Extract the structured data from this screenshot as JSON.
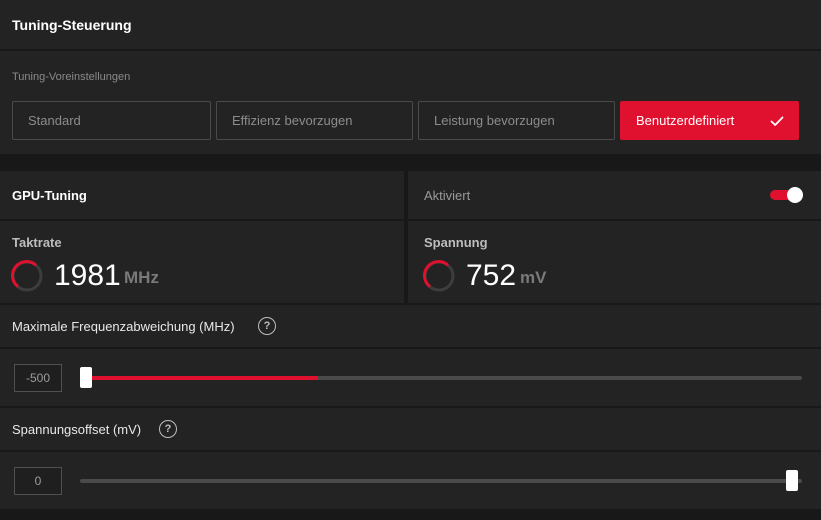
{
  "header": {
    "title": "Tuning-Steuerung"
  },
  "presets": {
    "label": "Tuning-Voreinstellungen",
    "items": [
      {
        "label": "Standard"
      },
      {
        "label": "Effizienz bevorzugen"
      },
      {
        "label": "Leistung bevorzugen"
      },
      {
        "label": "Benutzerdefiniert"
      }
    ],
    "selected": "Benutzerdefiniert"
  },
  "gpu_tuning": {
    "title": "GPU-Tuning",
    "status_label": "Aktiviert",
    "enabled": true
  },
  "stats": {
    "clock": {
      "label": "Taktrate",
      "value": "1981",
      "unit": "MHz"
    },
    "voltage": {
      "label": "Spannung",
      "value": "752",
      "unit": "mV"
    }
  },
  "frequency": {
    "title": "Maximale Frequenzabweichung (MHz)",
    "help_glyph": "?",
    "value": "-500",
    "slider_level": 0.0,
    "highlight_end": 0.33
  },
  "voltage_offset": {
    "title": "Spannungsoffset (mV)",
    "help_glyph": "?",
    "value": "0",
    "slider_level": 1.0
  },
  "colors": {
    "accent": "#e0102f",
    "panel": "#232323",
    "background": "#181818"
  },
  "icons": {
    "check": "check-icon",
    "help": "help-circle-icon",
    "gauge": "gauge-arc-icon"
  }
}
